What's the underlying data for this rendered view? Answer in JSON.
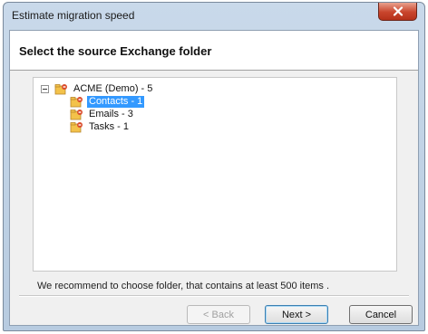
{
  "window": {
    "title": "Estimate migration speed",
    "close_icon": "close-icon"
  },
  "header": {
    "title": "Select the source Exchange folder"
  },
  "tree": {
    "root": {
      "label": "ACME (Demo) - 5",
      "expander": "minus-icon",
      "icon": "exchange-folder-icon"
    },
    "children": [
      {
        "label": "Contacts - 1",
        "selected": true,
        "icon": "exchange-folder-icon"
      },
      {
        "label": "Emails - 3",
        "selected": false,
        "icon": "exchange-folder-icon"
      },
      {
        "label": "Tasks - 1",
        "selected": false,
        "icon": "exchange-folder-icon"
      }
    ]
  },
  "hint_text": "We recommend to choose folder, that contains at least 500 items .",
  "buttons": {
    "back_label": "< Back",
    "next_label": "Next >",
    "cancel_label": "Cancel"
  },
  "colors": {
    "selection": "#3399ff",
    "close_button": "#c9452c",
    "dialog_background": "#f0f0f0"
  }
}
